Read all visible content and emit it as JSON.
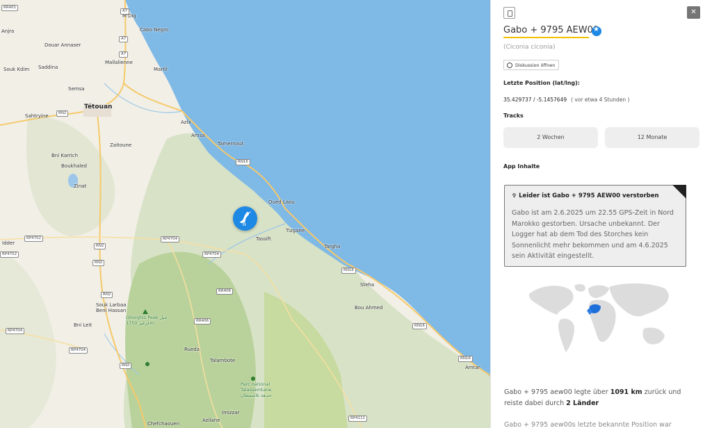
{
  "map": {
    "places": [
      {
        "name": "Anjra",
        "cls": ""
      },
      {
        "name": "M'Diq",
        "cls": ""
      },
      {
        "name": "Cabo Negro",
        "cls": ""
      },
      {
        "name": "Douar Annaser",
        "cls": ""
      },
      {
        "name": "Mallalienne",
        "cls": ""
      },
      {
        "name": "Souk Kdim",
        "cls": ""
      },
      {
        "name": "Saddina",
        "cls": ""
      },
      {
        "name": "Martil",
        "cls": ""
      },
      {
        "name": "Semsa",
        "cls": ""
      },
      {
        "name": "Tétouan",
        "cls": "big"
      },
      {
        "name": "Sahtryine",
        "cls": ""
      },
      {
        "name": "Azla",
        "cls": ""
      },
      {
        "name": "Zaitoune",
        "cls": ""
      },
      {
        "name": "Amsa",
        "cls": ""
      },
      {
        "name": "Tamernout",
        "cls": ""
      },
      {
        "name": "Bni Karrich",
        "cls": ""
      },
      {
        "name": "Boukhaled",
        "cls": ""
      },
      {
        "name": "Zinat",
        "cls": ""
      },
      {
        "name": "Oued Laou",
        "cls": ""
      },
      {
        "name": "Tizgane",
        "cls": ""
      },
      {
        "name": "Tassift",
        "cls": ""
      },
      {
        "name": "Targha",
        "cls": ""
      },
      {
        "name": "Idder",
        "cls": ""
      },
      {
        "name": "Stehа",
        "cls": ""
      },
      {
        "name": "Souk Larbaa\nBeni Hassan",
        "cls": ""
      },
      {
        "name": "Bou Ahmed",
        "cls": ""
      },
      {
        "name": "Bni Leit",
        "cls": ""
      },
      {
        "name": "Rueda",
        "cls": ""
      },
      {
        "name": "Talambote",
        "cls": ""
      },
      {
        "name": "Amtar",
        "cls": ""
      },
      {
        "name": "Chefchaouen",
        "cls": ""
      },
      {
        "name": "Azilane",
        "cls": ""
      },
      {
        "name": "Imizzar",
        "cls": ""
      },
      {
        "name": "Ghorghiz Peak جبل\nغرغيز 1750m",
        "cls": "green"
      },
      {
        "name": "Parc national\nTalassemtane\nحديقة تلاسمطان",
        "cls": "green"
      }
    ],
    "roads": [
      "RR401",
      "A7",
      "A7",
      "A7",
      "RN2",
      "RN16",
      "RP4702",
      "RP4702",
      "RN2",
      "RN2",
      "RP4704",
      "RP4704",
      "RN16",
      "RR406",
      "RN2",
      "RP4704",
      "RR406",
      "RN16",
      "RP4704",
      "RN2",
      "RN16",
      "RP4111"
    ]
  },
  "panel": {
    "title": "Gabo + 9795 AEW00",
    "scientific_name": "(Ciconia ciconia)",
    "discussion_label": "Diskussion öffnen",
    "last_position_heading": "Letzte Position (lat/lng):",
    "coords": "35.429737 / -5.1457649",
    "coords_relative": "( vor etwa 4 Stunden )",
    "tracks_heading": "Tracks",
    "track_buttons": [
      "2 Wochen",
      "12 Monate"
    ],
    "app_content_heading": "App Inhalte",
    "deceased_heading": "✞ Leider ist Gabo + 9795 AEW00 verstorben",
    "deceased_body": "Gabo ist am 2.6.2025 um 22.55 GPS-Zeit in Nord Marokko gestorben. Ursache unbekannt. Der Logger hat ab dem Tod des Storches kein Sonnenlicht mehr bekommen und am 4.6.2025 sein Aktivität eingestellt.",
    "summary_prefix": "Gabo + 9795 aew00 legte über ",
    "summary_km": "1091 km",
    "summary_mid": " zurück und reiste dabei durch ",
    "summary_countries": "2 Länder",
    "summary2": "Gabo + 9795 aew00s letzte bekannte Position war"
  },
  "colors": {
    "sea": "#7fb9e6",
    "land": "#f1efe6",
    "forest": "#cddfb8",
    "marker": "#1e88e5",
    "highlight": "#f2c200"
  }
}
